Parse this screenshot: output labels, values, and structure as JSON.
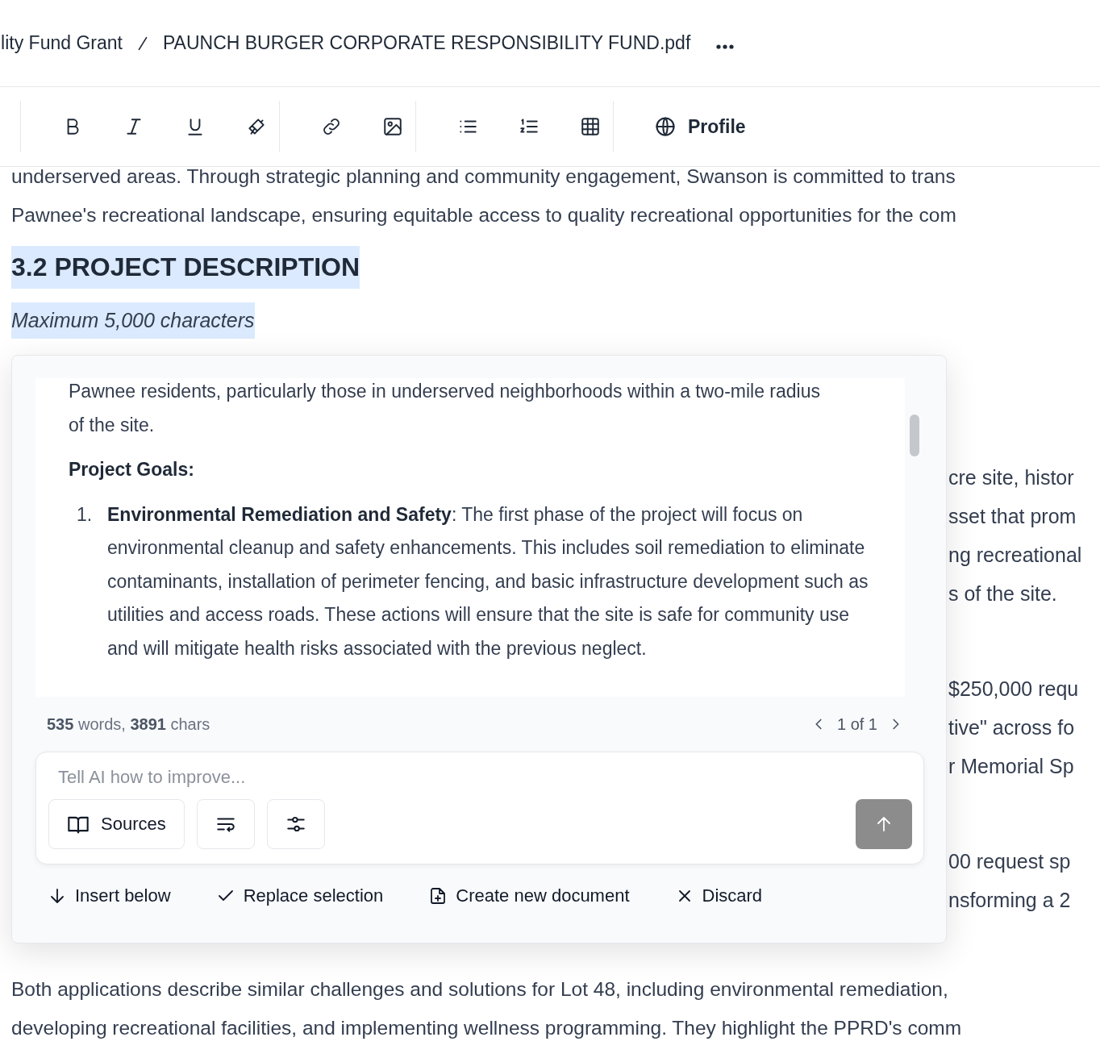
{
  "breadcrumb": {
    "parent": "ility Fund Grant",
    "current": "PAUNCH BURGER CORPORATE RESPONSIBILITY FUND.pdf"
  },
  "toolbar": {
    "profile": "Profile"
  },
  "document": {
    "top_lines": [
      "underserved areas. Through strategic planning and community engagement, Swanson is committed to trans",
      "Pawnee's recreational landscape, ensuring equitable access to quality recreational opportunities for the com"
    ],
    "heading": "3.2 PROJECT DESCRIPTION",
    "hint": "Maximum 5,000 characters",
    "side_fragments": [
      [
        "cre site, histor",
        "sset that prom",
        "ng recreational",
        "s of the site."
      ],
      [
        "$250,000 requ",
        "tive\" across fo",
        "r Memorial Sp"
      ],
      [
        "00 request sp",
        "nsforming a 2"
      ]
    ],
    "bottom_lines": [
      "Both applications describe similar challenges and solutions for Lot 48, including environmental remediation,",
      "developing recreational facilities, and implementing wellness programming. They highlight the PPRD's comm"
    ]
  },
  "ai_panel": {
    "draft": [
      {
        "kind": "paragraph",
        "text": "Pawnee residents, particularly those in underserved neighborhoods within a two-mile radius of the site."
      },
      {
        "kind": "subheading",
        "text": "Project Goals:"
      },
      {
        "kind": "list-item",
        "number": "1.",
        "text": "**Environmental Remediation and Safety**: The first phase of the project will focus on environmental cleanup and safety enhancements. This includes soil remediation to eliminate contaminants, installation of perimeter fencing, and basic infrastructure development such as utilities and access roads. These actions will ensure that the site is safe for community use and will mitigate health risks associated with the previous neglect."
      }
    ],
    "stats": "**535** words, **3891** chars",
    "pager": "1 of 1",
    "prompt": {
      "placeholder": "Tell AI how to improve...",
      "sources": "Sources",
      "send_disabled": true
    },
    "actions": [
      {
        "kind": "insert",
        "label": "Insert below"
      },
      {
        "kind": "replace",
        "label": "Replace selection"
      },
      {
        "kind": "create",
        "label": "Create new document"
      },
      {
        "kind": "discard",
        "label": "Discard"
      }
    ]
  }
}
